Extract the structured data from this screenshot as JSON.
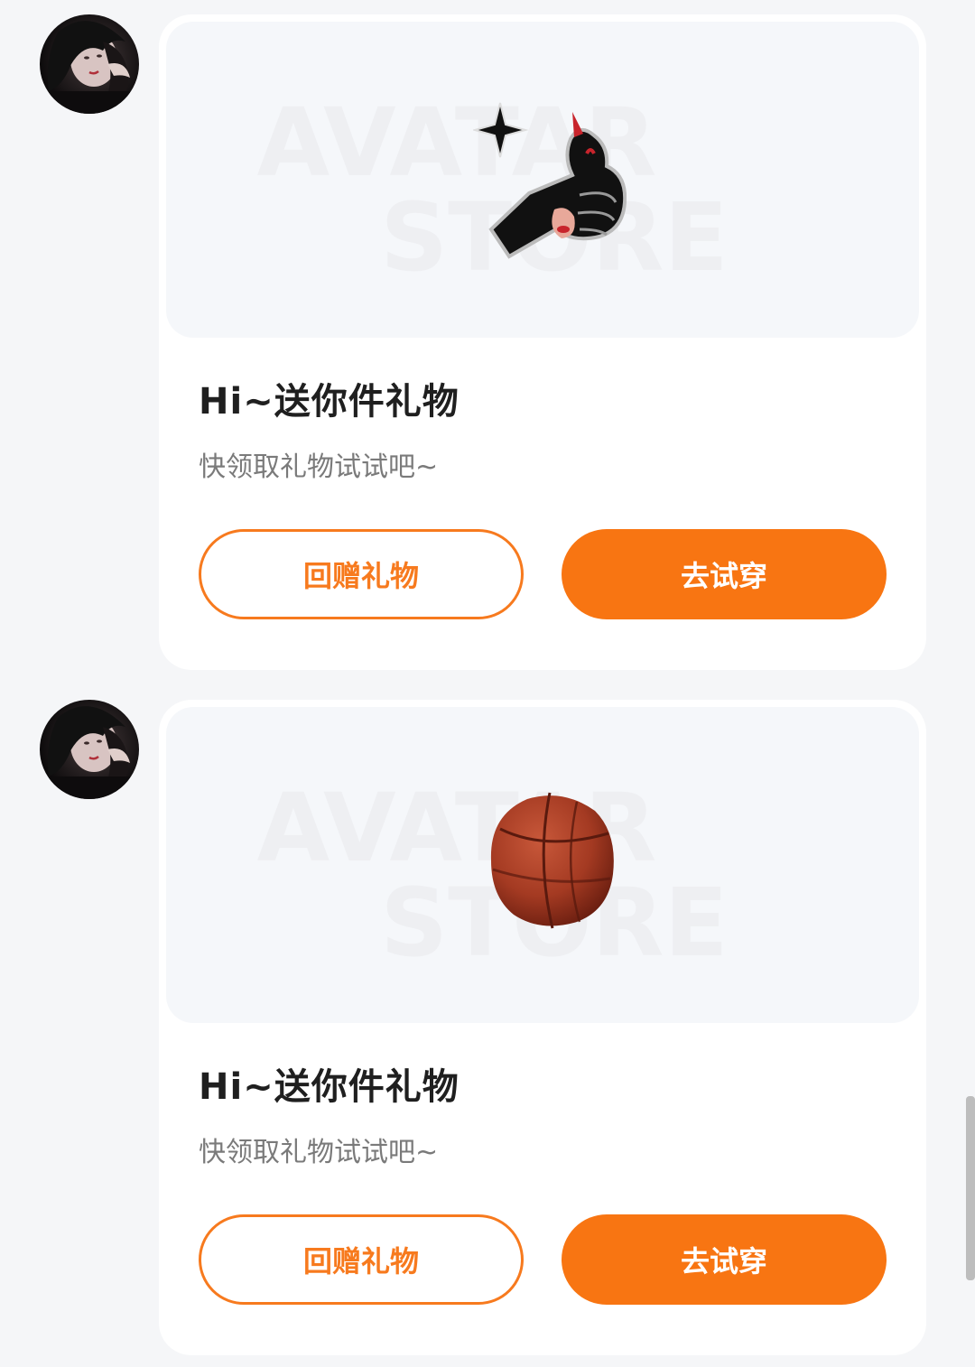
{
  "messages": [
    {
      "gift_icon": "rock-hand-sticker-icon",
      "title": "Hi~送你件礼物",
      "subtitle": "快领取礼物试试吧~",
      "return_gift_label": "回赠礼物",
      "try_on_label": "去试穿",
      "watermark_line1": "AVATAR",
      "watermark_line2": "STORE"
    },
    {
      "gift_icon": "basketball-icon",
      "title": "Hi~送你件礼物",
      "subtitle": "快领取礼物试试吧~",
      "return_gift_label": "回赠礼物",
      "try_on_label": "去试穿",
      "watermark_line1": "AVATAR",
      "watermark_line2": "STORE"
    }
  ],
  "colors": {
    "accent": "#f87512",
    "page_background": "#f5f6f8",
    "card_background": "#ffffff"
  }
}
